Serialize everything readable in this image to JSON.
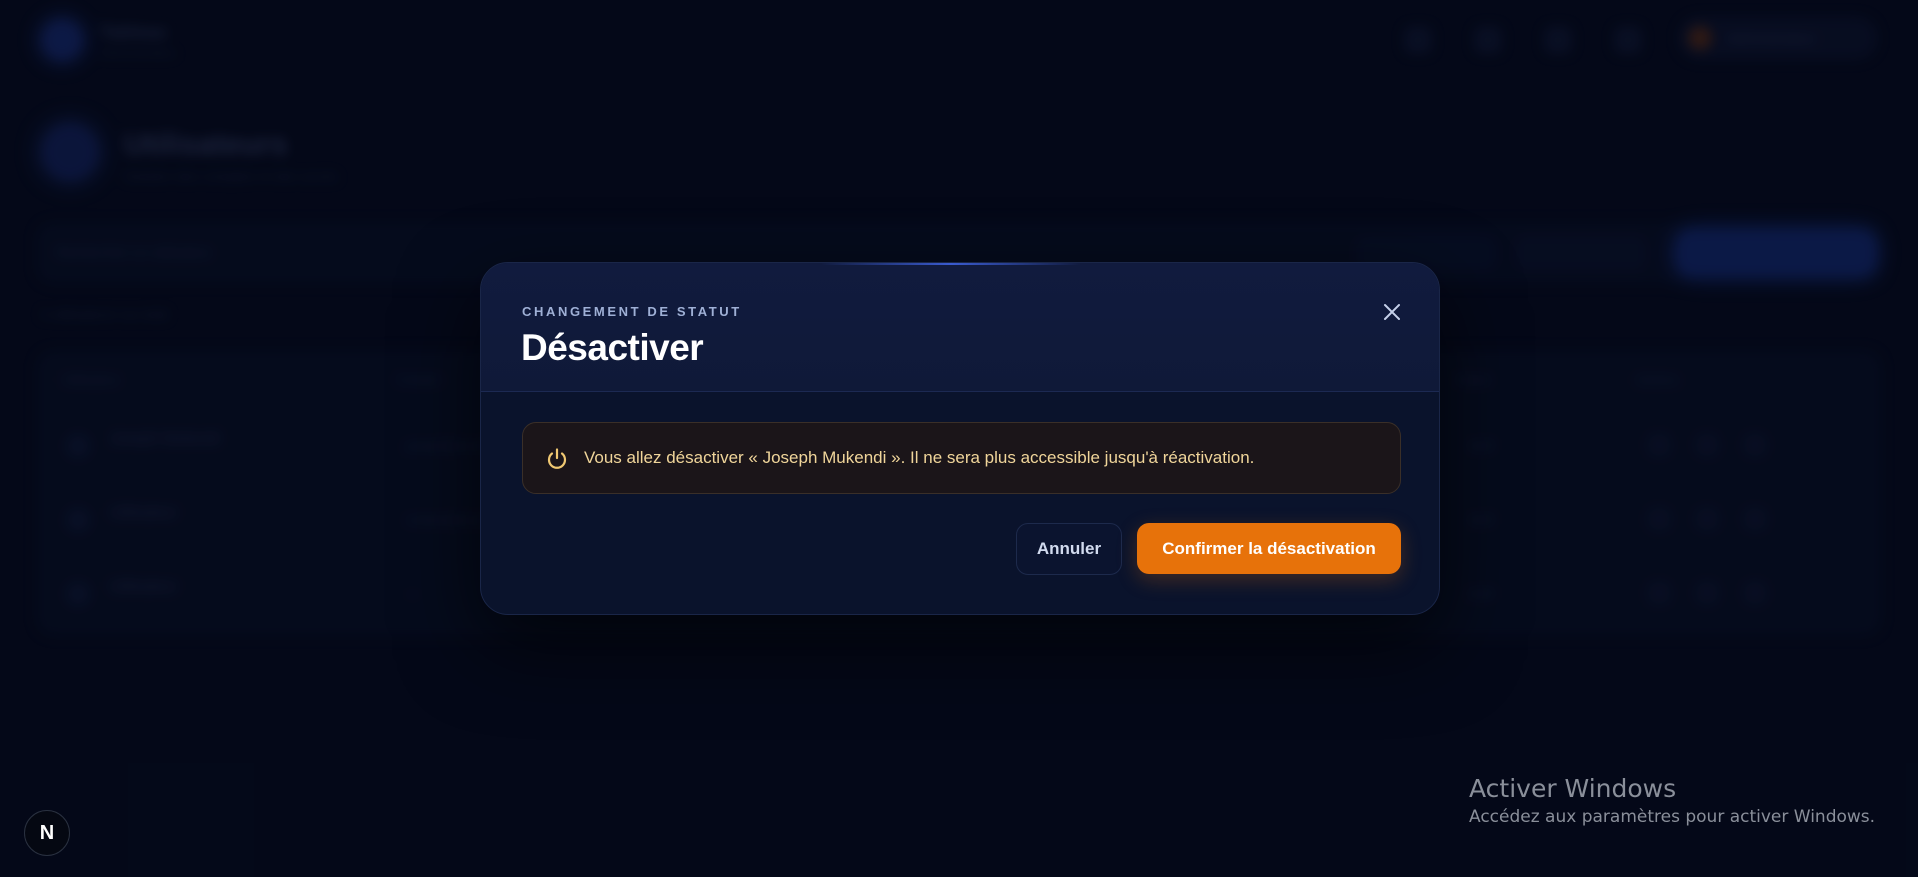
{
  "background": {
    "app_title": "Tableau",
    "app_subtitle": "Administration",
    "user_name": "Administrateur",
    "page_title": "Utilisateurs",
    "page_subtitle": "Gestion des comptes et des accès",
    "search_placeholder": "Rechercher un utilisateur",
    "results_count": "3 utilisateurs au total",
    "table_headers": [
      "Utilisateur",
      "Contact",
      "Statut",
      "Actions"
    ],
    "rows": [
      {
        "name": "Joseph Mukendi",
        "contact": "joseph@exemple.cd",
        "status": "Actif"
      },
      {
        "name": "Utilisateur",
        "contact": "contact@exemple.cd",
        "status": "Actif"
      },
      {
        "name": "Utilisateur",
        "contact": "—",
        "status": "Actif"
      }
    ]
  },
  "modal": {
    "eyebrow": "CHANGEMENT DE STATUT",
    "title": "Désactiver",
    "close_icon": "close-icon",
    "warning": {
      "icon": "power-icon",
      "text": "Vous allez désactiver « Joseph Mukendi ». Il ne sera plus accessible jusqu'à réactivation."
    },
    "cancel_label": "Annuler",
    "confirm_label": "Confirmer la désactivation"
  },
  "watermark": {
    "title": "Activer Windows",
    "subtitle": "Accédez aux paramètres pour activer Windows."
  },
  "corner_badge": "N",
  "colors": {
    "background": "#050a1c",
    "modal_bg": "#0a132c",
    "modal_header_bg": "#111b3e",
    "warning_bg": "#1b1519",
    "warning_text": "#f0d59a",
    "accent_orange": "#e7720a",
    "primary_blue": "#1a3a9e"
  }
}
